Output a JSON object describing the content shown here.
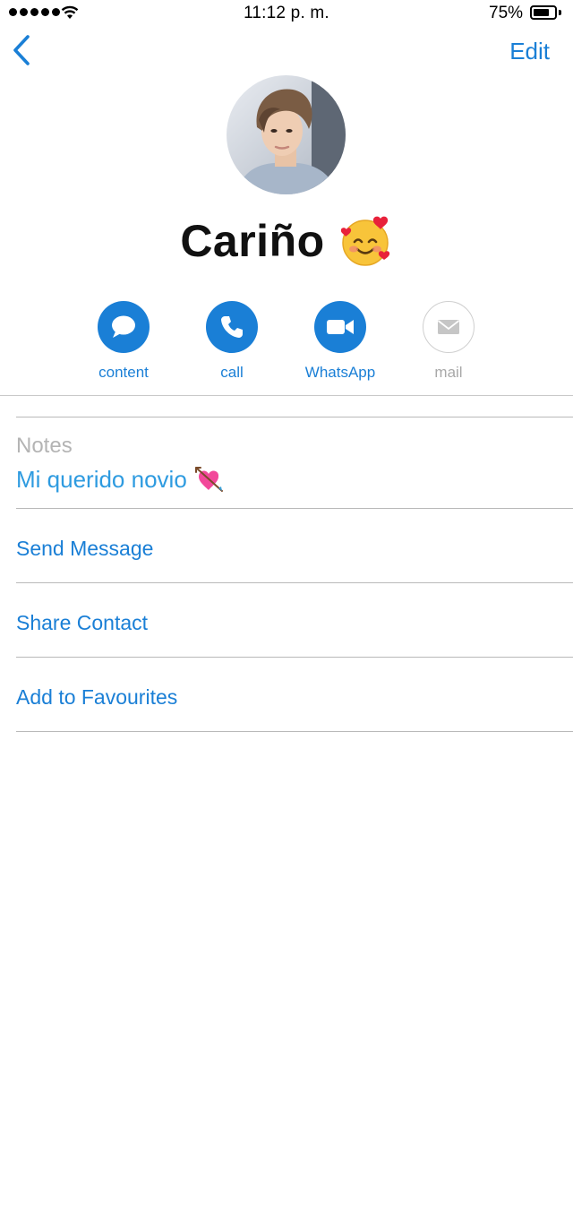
{
  "status_bar": {
    "time": "11:12 p. m.",
    "battery": "75%",
    "battery_level": 0.75
  },
  "nav": {
    "edit_label": "Edit"
  },
  "contact": {
    "name": "Cariño"
  },
  "actions": [
    {
      "label": "content",
      "icon": "message-bubble-icon",
      "enabled": true
    },
    {
      "label": "call",
      "icon": "phone-icon",
      "enabled": true
    },
    {
      "label": "WhatsApp",
      "icon": "video-camera-icon",
      "enabled": true
    },
    {
      "label": "mail",
      "icon": "envelope-icon",
      "enabled": false
    }
  ],
  "notes": {
    "label": "Notes",
    "value": "Mi querido novio"
  },
  "rows": {
    "send_message": "Send Message",
    "share_contact": "Share Contact",
    "add_favourites": "Add to Favourites"
  },
  "colors": {
    "accent": "#1a7fd6",
    "notes_text": "#2e9be0",
    "disabled": "#a8a8a8"
  }
}
